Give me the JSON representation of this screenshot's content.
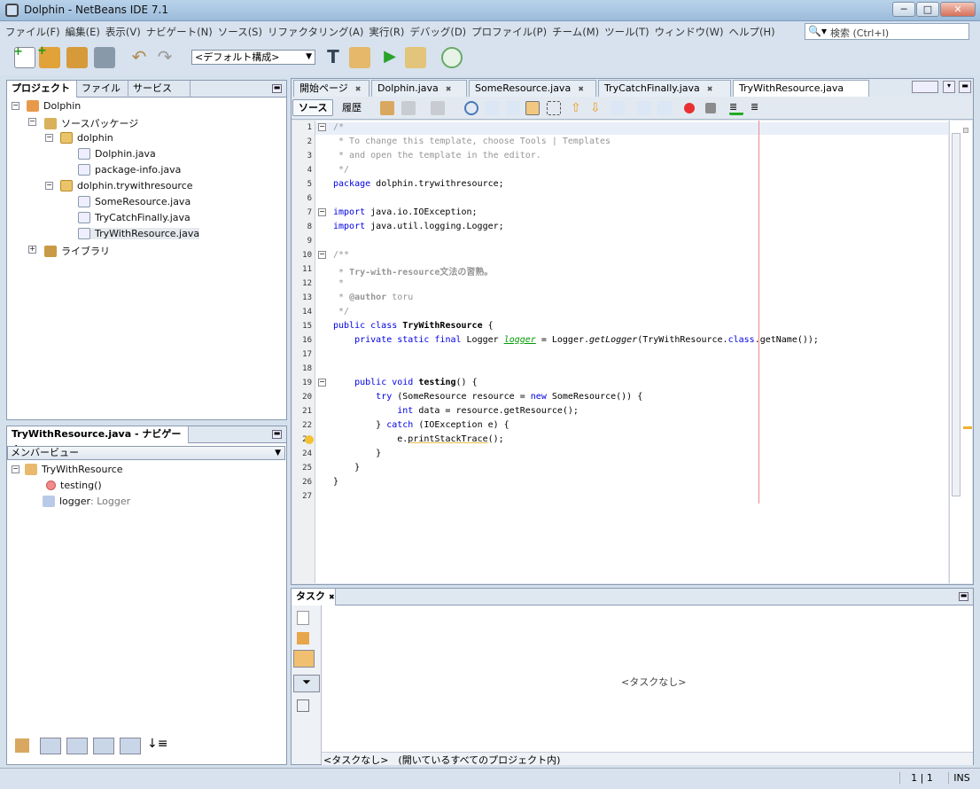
{
  "window": {
    "title": "Dolphin - NetBeans IDE 7.1",
    "btn_min": "─",
    "btn_max": "□",
    "btn_close": "✕"
  },
  "menu": {
    "items": [
      "ファイル(F)",
      "編集(E)",
      "表示(V)",
      "ナビゲート(N)",
      "ソース(S)",
      "リファクタリング(A)",
      "実行(R)",
      "デバッグ(D)",
      "プロファイル(P)",
      "チーム(M)",
      "ツール(T)",
      "ウィンドウ(W)",
      "ヘルプ(H)"
    ]
  },
  "search": {
    "placeholder": "検索 (Ctrl+I)"
  },
  "toolbar": {
    "config": "<デフォルト構成>"
  },
  "projects": {
    "tabs": [
      "プロジェクト",
      "ファイル",
      "サービス"
    ],
    "tree": [
      {
        "label": "Dolphin"
      },
      {
        "label": "ソースパッケージ"
      },
      {
        "label": "dolphin"
      },
      {
        "label": "Dolphin.java"
      },
      {
        "label": "package-info.java"
      },
      {
        "label": "dolphin.trywithresource"
      },
      {
        "label": "SomeResource.java"
      },
      {
        "label": "TryCatchFinally.java"
      },
      {
        "label": "TryWithResource.java"
      },
      {
        "label": "ライブラリ"
      }
    ]
  },
  "navigator": {
    "title": "TryWithResource.java - ナビゲータ",
    "view": "メンバービュー",
    "class_name": "TryWithResource",
    "members": [
      {
        "label": "testing()"
      },
      {
        "label": "logger",
        "type": " : Logger"
      }
    ]
  },
  "editor": {
    "tabs": [
      "開始ページ",
      "Dolphin.java",
      "SomeResource.java",
      "TryCatchFinally.java",
      "TryWithResource.java"
    ],
    "source_btn": "ソース",
    "history_btn": "履歴",
    "line_numbers": [
      "1",
      "2",
      "3",
      "4",
      "5",
      "6",
      "7",
      "8",
      "9",
      "10",
      "11",
      "12",
      "13",
      "14",
      "15",
      "16",
      "17",
      "18",
      "19",
      "20",
      "21",
      "22",
      "23",
      "24",
      "25",
      "26",
      "27"
    ]
  },
  "tasks": {
    "title": "タスク",
    "empty": "<タスクなし>",
    "filter": "<タスクなし>　(開いているすべてのプロジェクト内)"
  },
  "status": {
    "position": "1 | 1",
    "mode": "INS"
  }
}
